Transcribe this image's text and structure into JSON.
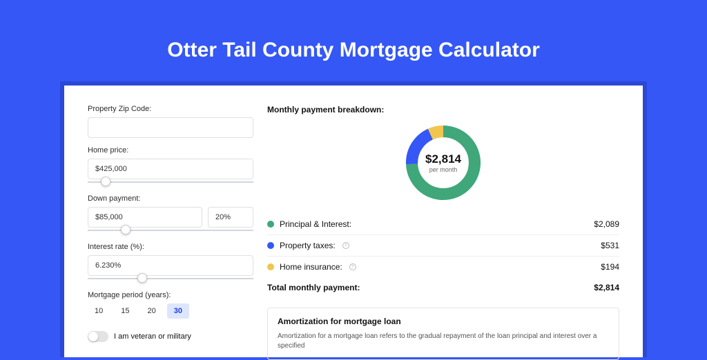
{
  "title": "Otter Tail County Mortgage Calculator",
  "colors": {
    "pi": "#3fa77a",
    "tax": "#3457f5",
    "ins": "#f0c64e"
  },
  "form": {
    "zip_label": "Property Zip Code:",
    "zip_value": "",
    "home_price_label": "Home price:",
    "home_price_value": "$425,000",
    "home_price_slider_pct": 8,
    "down_label": "Down payment:",
    "down_value": "$85,000",
    "down_pct": "20%",
    "down_slider_pct": 20,
    "rate_label": "Interest rate (%):",
    "rate_value": "6.230%",
    "rate_slider_pct": 30,
    "period_label": "Mortgage period (years):",
    "periods": [
      "10",
      "15",
      "20",
      "30"
    ],
    "period_selected": "30",
    "veteran_label": "I am veteran or military"
  },
  "breakdown": {
    "title": "Monthly payment breakdown:",
    "center_amount": "$2,814",
    "center_sub": "per month",
    "items": [
      {
        "label": "Principal & Interest:",
        "value": "$2,089",
        "color": "#3fa77a",
        "info": false
      },
      {
        "label": "Property taxes:",
        "value": "$531",
        "color": "#3457f5",
        "info": true
      },
      {
        "label": "Home insurance:",
        "value": "$194",
        "color": "#f0c64e",
        "info": true
      }
    ],
    "total_label": "Total monthly payment:",
    "total_value": "$2,814"
  },
  "chart_data": {
    "type": "pie",
    "title": "Monthly payment breakdown",
    "series": [
      {
        "name": "Principal & Interest",
        "value": 2089
      },
      {
        "name": "Property taxes",
        "value": 531
      },
      {
        "name": "Home insurance",
        "value": 194
      }
    ],
    "total": 2814,
    "unit": "USD/month"
  },
  "amort": {
    "title": "Amortization for mortgage loan",
    "text": "Amortization for a mortgage loan refers to the gradual repayment of the loan principal and interest over a specified"
  }
}
